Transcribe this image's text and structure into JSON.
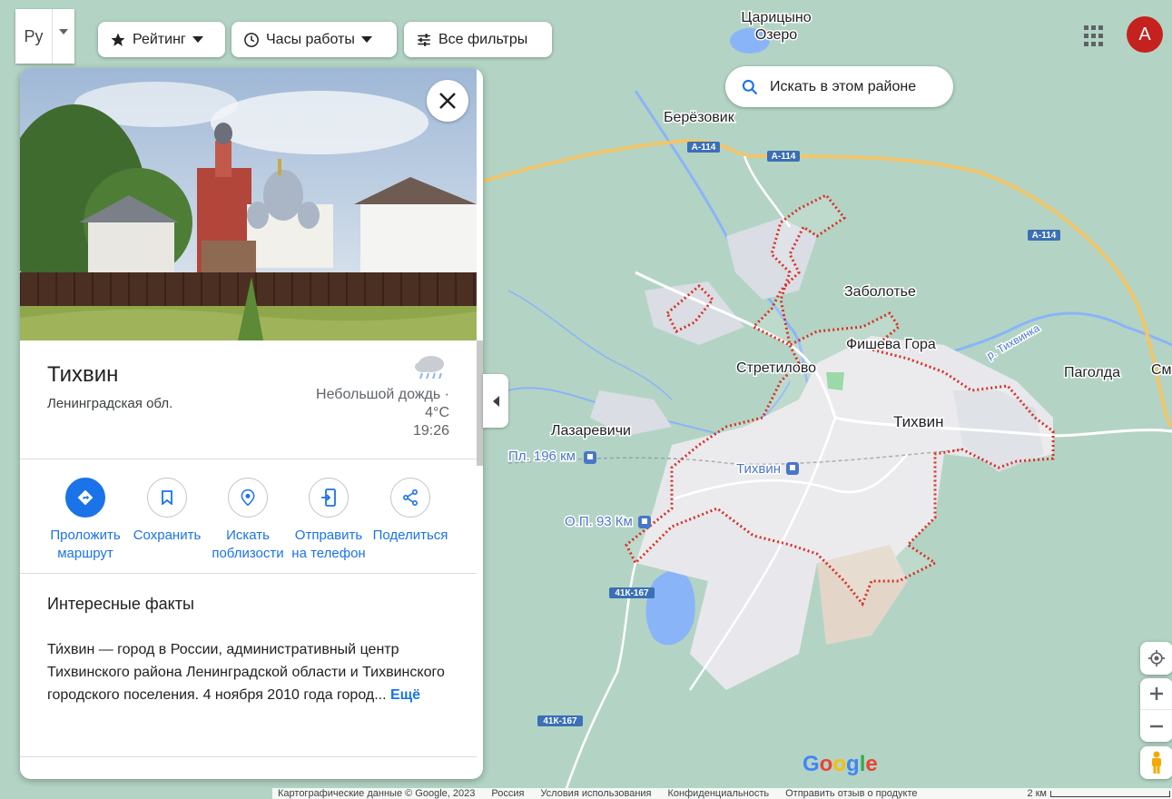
{
  "toolbar": {
    "lang_label": "Ру",
    "chips": {
      "rating": "Рейтинг",
      "hours": "Часы работы",
      "all_filters": "Все фильтры"
    },
    "search_area": "Искать в этом районе",
    "account_initial": "A"
  },
  "place": {
    "name": "Тихвин",
    "region": "Ленинградская обл.",
    "weather": {
      "condition": "Небольшой дождь ·",
      "temperature": "4°C",
      "time": "19:26",
      "icon": "rain-cloud-icon"
    },
    "actions": {
      "directions": "Проложить маршрут",
      "save": "Сохранить",
      "nearby": "Искать поблизости",
      "send_phone": "Отправить на телефон",
      "share": "Поделиться"
    },
    "facts_heading": "Интересные факты",
    "facts_text": "Ти́хвин — город в России, административный центр Тихвинского района Ленинградской области и Тихвинского городского поселения. 4 ноября 2010 года город...",
    "facts_more": "Ещё"
  },
  "map": {
    "labels": {
      "lake": "Царицыно Озеро",
      "lake_line1": "Царицыно",
      "lake_line2": "Озеро",
      "berezovik": "Берёзовик",
      "zabolotye": "Заболотье",
      "fisheva": "Фишева Гора",
      "stretilovo": "Стретилово",
      "tikhvin": "Тихвин",
      "pagolda": "Паголда",
      "sm": "См",
      "lazarevichi": "Лазаревичи",
      "river": "р. Тихвинка"
    },
    "stations": {
      "pl196": "Пл. 196 км",
      "tikhvin_station": "Тихвин",
      "op93": "О.П. 93 Км"
    },
    "routes": {
      "a114": "А-114",
      "k167": "41К-167"
    }
  },
  "footer": {
    "data": "Картографические данные © Google, 2023",
    "country": "Россия",
    "terms": "Условия использования",
    "privacy": "Конфиденциальность",
    "feedback": "Отправить отзыв о продукте",
    "scale": "2 км"
  },
  "google_logo": "Google",
  "colors": {
    "accent": "#1a73e8",
    "boundary": "#d93025",
    "map_bg": "#b3d4c4",
    "road_major": "#f4c96b",
    "avatar": "#c5221f"
  }
}
